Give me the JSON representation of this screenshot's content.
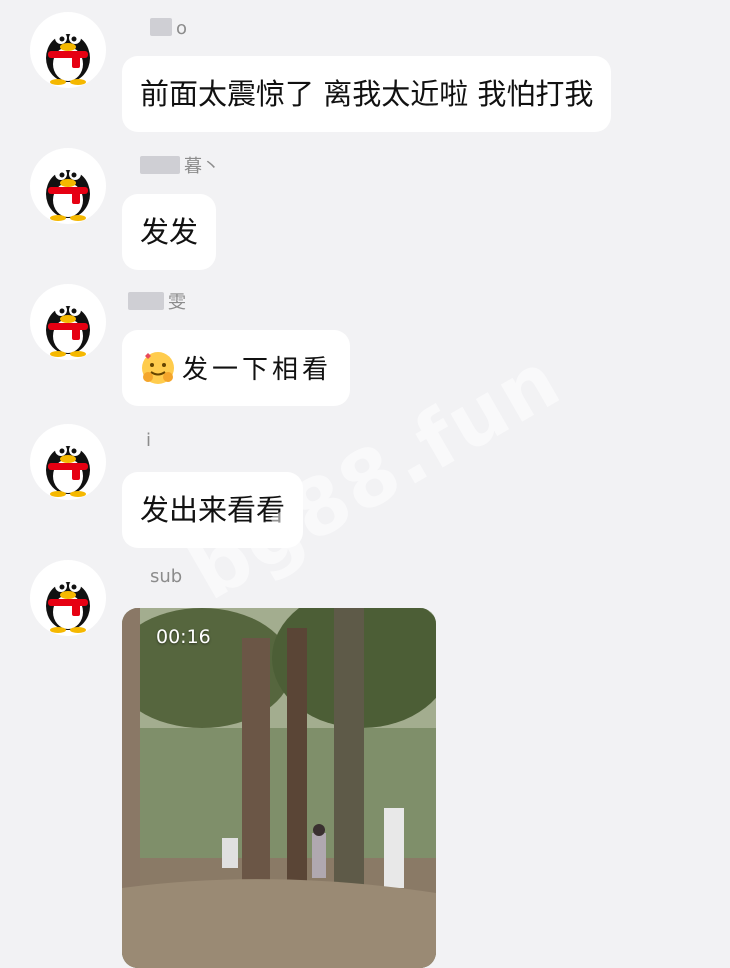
{
  "messages": [
    {
      "sender": "o",
      "text": "前面太震惊了 离我太近啦 我怕打我"
    },
    {
      "sender": "暮丶",
      "text": "发发"
    },
    {
      "sender": "雯",
      "text": "发一下相看"
    },
    {
      "sender": "i",
      "text": "发出来看看"
    },
    {
      "sender": "sub",
      "video_duration": "00:16"
    }
  ],
  "watermark": "bg88.fun",
  "colors": {
    "background": "#f2f2f4",
    "bubble": "#ffffff",
    "penguin_scarf": "#e60012"
  },
  "icons": [
    "qq-penguin-avatar-icon",
    "hug-emoji-icon"
  ]
}
